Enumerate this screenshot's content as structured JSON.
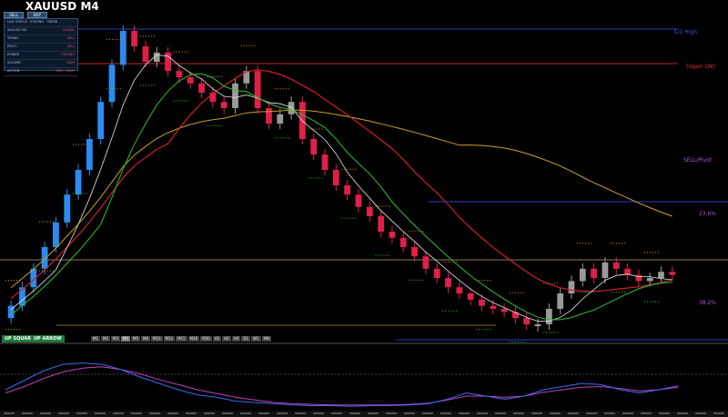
{
  "title": "XAUUSD M4",
  "top_buttons": [
    "SELL",
    "BUY"
  ],
  "info_panel": {
    "header": "LIVE STATUS · STRONG · TREND",
    "rows": [
      {
        "label": "XAUUSD M4",
        "value": "SIGNAL"
      },
      {
        "label": "TREND",
        "value": "SELL"
      },
      {
        "label": "PIVOT",
        "value": "SELL"
      },
      {
        "label": "POWER",
        "value": "STRONG"
      },
      {
        "label": "VOLUME",
        "value": "HIGH"
      },
      {
        "label": "ACTION",
        "value": "SELL / WAIT"
      }
    ]
  },
  "levels": [
    {
      "label": "1/1 High",
      "color": "#3a55e8"
    },
    {
      "label": "[Open ON]",
      "color": "#e03030"
    },
    {
      "label": "SELL/Pivot",
      "color": "#b455d6"
    },
    {
      "label": "23.6%",
      "color": "#b455d6"
    },
    {
      "label": "38.2%",
      "color": "#b455d6"
    }
  ],
  "bottom_buttons": [
    {
      "label": "UP SQUARE",
      "color": "#1e7a3a"
    },
    {
      "label": "UP ARROW",
      "color": "#1e7a3a"
    }
  ],
  "timeframes": [
    "M1",
    "M2",
    "M3",
    "M4",
    "M5",
    "M6",
    "M10",
    "M12",
    "M15",
    "M20",
    "M30",
    "H1",
    "H2",
    "H4",
    "D1",
    "W1",
    "MN"
  ],
  "active_timeframe": "M4",
  "colors": {
    "bull_candle": "#9a9a9a",
    "bear_candle": "#e0204a",
    "early_bull_candle": "#2a8cf0",
    "slow_ma": "#c9a227",
    "red_ma": "#d0202a",
    "white_ma": "#e8e8e8",
    "green_ma": "#30c030",
    "osc_main": "#3a6cf0",
    "osc_signal": "#c040c0"
  },
  "chart_data": {
    "type": "candlestick",
    "candles_close_trend": [
      0.06,
      0.12,
      0.18,
      0.25,
      0.33,
      0.42,
      0.5,
      0.6,
      0.72,
      0.84,
      0.95,
      0.9,
      0.85,
      0.88,
      0.82,
      0.8,
      0.78,
      0.75,
      0.72,
      0.7,
      0.78,
      0.82,
      0.7,
      0.65,
      0.68,
      0.72,
      0.6,
      0.55,
      0.5,
      0.45,
      0.42,
      0.38,
      0.35,
      0.3,
      0.28,
      0.25,
      0.22,
      0.18,
      0.15,
      0.12,
      0.1,
      0.08,
      0.06,
      0.05,
      0.04,
      0.02,
      0.0,
      0.0,
      0.05,
      0.1,
      0.14,
      0.18,
      0.15,
      0.2,
      0.18,
      0.16,
      0.14,
      0.15,
      0.17,
      0.16
    ],
    "oscillator_main": [
      0.3,
      0.45,
      0.6,
      0.7,
      0.72,
      0.7,
      0.62,
      0.5,
      0.4,
      0.3,
      0.22,
      0.18,
      0.12,
      0.1,
      0.08,
      0.06,
      0.05,
      0.05,
      0.04,
      0.05,
      0.05,
      0.06,
      0.08,
      0.15,
      0.25,
      0.2,
      0.15,
      0.2,
      0.3,
      0.35,
      0.4,
      0.38,
      0.3,
      0.25,
      0.3,
      0.36
    ],
    "oscillator_signal": [
      0.25,
      0.35,
      0.48,
      0.58,
      0.64,
      0.66,
      0.62,
      0.55,
      0.46,
      0.38,
      0.3,
      0.24,
      0.18,
      0.14,
      0.1,
      0.08,
      0.07,
      0.06,
      0.06,
      0.06,
      0.06,
      0.07,
      0.09,
      0.14,
      0.2,
      0.2,
      0.18,
      0.2,
      0.26,
      0.3,
      0.34,
      0.35,
      0.32,
      0.28,
      0.3,
      0.34
    ]
  }
}
